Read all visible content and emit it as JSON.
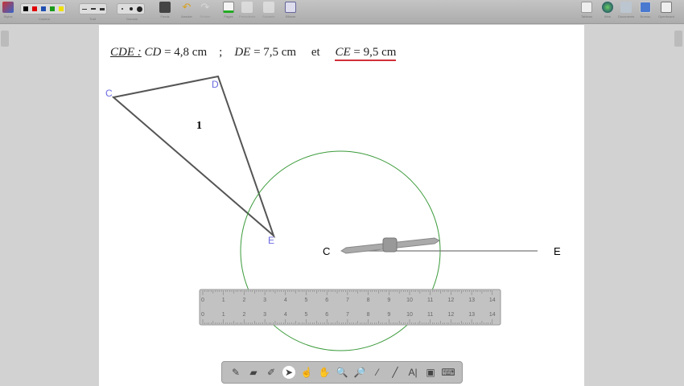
{
  "toolbar": {
    "left": [
      {
        "label": "Stylos",
        "icon": "pen-icon"
      },
      {
        "label": "Fonds",
        "icon": "background-icon"
      },
      {
        "label": "Annuler",
        "icon": "undo-icon"
      },
      {
        "label": "Refaire",
        "icon": "redo-icon"
      },
      {
        "label": "Pages",
        "icon": "pages-icon"
      },
      {
        "label": "Précédente",
        "icon": "previous-icon"
      },
      {
        "label": "Suivante",
        "icon": "next-icon"
      },
      {
        "label": "Effacer",
        "icon": "clear-icon"
      }
    ],
    "groups": {
      "color": "Couleur",
      "line": "Trait",
      "eraser": "Gomme"
    },
    "colors": [
      "#000000",
      "#e00000",
      "#1f4fb0",
      "#1a9a1a",
      "#f0e000"
    ],
    "right": [
      {
        "label": "Tableau",
        "icon": "board-icon"
      },
      {
        "label": "Web",
        "icon": "globe-icon"
      },
      {
        "label": "Documents",
        "icon": "folder-icon"
      },
      {
        "label": "Bureau",
        "icon": "desktop-icon"
      },
      {
        "label": "Openboard",
        "icon": "settings-icon"
      }
    ]
  },
  "formula": {
    "name": "CDE :",
    "cd": "CD",
    "cd_val": " = 4,8 cm",
    "sep": "    ;    ",
    "de": "DE",
    "de_val": " = 7,5 cm",
    "et": "     et     ",
    "ce": "CE",
    "ce_val": " = 9,5 cm"
  },
  "triangle": {
    "c": "C",
    "d": "D",
    "e": "E",
    "number": "1"
  },
  "construction": {
    "c": "C",
    "e": "E"
  },
  "ruler": {
    "ticks": [
      "0",
      "1",
      "2",
      "3",
      "4",
      "5",
      "6",
      "7",
      "8",
      "9",
      "10",
      "11",
      "12",
      "13",
      "14"
    ]
  },
  "bottom_tools": [
    "pen-icon",
    "eraser-icon",
    "highlighter-icon",
    "select-arrow-icon",
    "hand-pointer-icon",
    "pan-hand-icon",
    "zoom-in-icon",
    "zoom-out-icon",
    "laser-pointer-icon",
    "line-icon",
    "text-icon",
    "capture-icon",
    "virtual-keyboard-icon"
  ],
  "accent": {
    "underline": "#d0303a",
    "circle": "#3a9a3a",
    "point_label": "#6a6ae0"
  }
}
